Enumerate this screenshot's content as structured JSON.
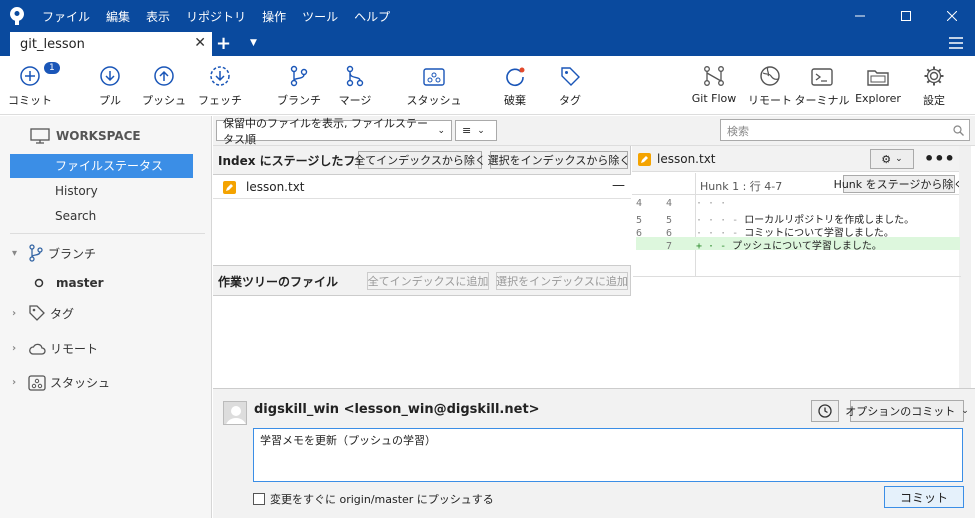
{
  "menu": [
    "ファイル",
    "編集",
    "表示",
    "リポジトリ",
    "操作",
    "ツール",
    "ヘルプ"
  ],
  "tab": {
    "name": "git_lesson"
  },
  "toolbar": {
    "commit": "コミット",
    "commit_badge": "1",
    "pull": "プル",
    "push": "プッシュ",
    "fetch": "フェッチ",
    "branch": "ブランチ",
    "merge": "マージ",
    "stash": "スタッシュ",
    "discard": "破棄",
    "tag": "タグ",
    "gitflow": "Git Flow",
    "remote": "リモート",
    "terminal": "ターミナル",
    "explorer": "Explorer",
    "settings": "設定"
  },
  "sidebar": {
    "workspace": "WORKSPACE",
    "file_status": "ファイルステータス",
    "history": "History",
    "search": "Search",
    "branches": "ブランチ",
    "master": "master",
    "tags": "タグ",
    "remotes": "リモート",
    "stashes": "スタッシュ"
  },
  "filter": {
    "show_files": "保留中のファイルを表示, ファイルステータス順",
    "view": "≡",
    "search_placeholder": "検索"
  },
  "staged": {
    "title": "Index にステージしたファイル",
    "unstage_all": "全てインデックスから除く",
    "unstage_selected": "選択をインデックスから除く",
    "files": [
      {
        "name": "lesson.txt"
      }
    ]
  },
  "unstaged": {
    "title": "作業ツリーのファイル",
    "stage_all": "全てインデックスに追加",
    "stage_selected": "選択をインデックスに追加"
  },
  "diff": {
    "file": "lesson.txt",
    "hunk_label": "Hunk 1 : 行 4-7",
    "unstage_hunk": "Hunk をステージから除く",
    "lines": [
      {
        "old": "4",
        "new": "4",
        "marker": "",
        "text": "· · ·"
      },
      {
        "old": "5",
        "new": "5",
        "marker": "· · · -",
        "text": "ローカルリポジトリを作成しました。"
      },
      {
        "old": "6",
        "new": "6",
        "marker": "· · · -",
        "text": "コミットについて学習しました。"
      },
      {
        "old": "",
        "new": "7",
        "marker": "+ · -",
        "text": "プッシュについて学習しました。"
      }
    ]
  },
  "commit": {
    "author": "digskill_win <lesson_win@digskill.net>",
    "options": "オプションのコミット",
    "message": "学習メモを更新（プッシュの学習）",
    "push_now": "変更をすぐに origin/master にプッシュする",
    "commit_button": "コミット"
  }
}
